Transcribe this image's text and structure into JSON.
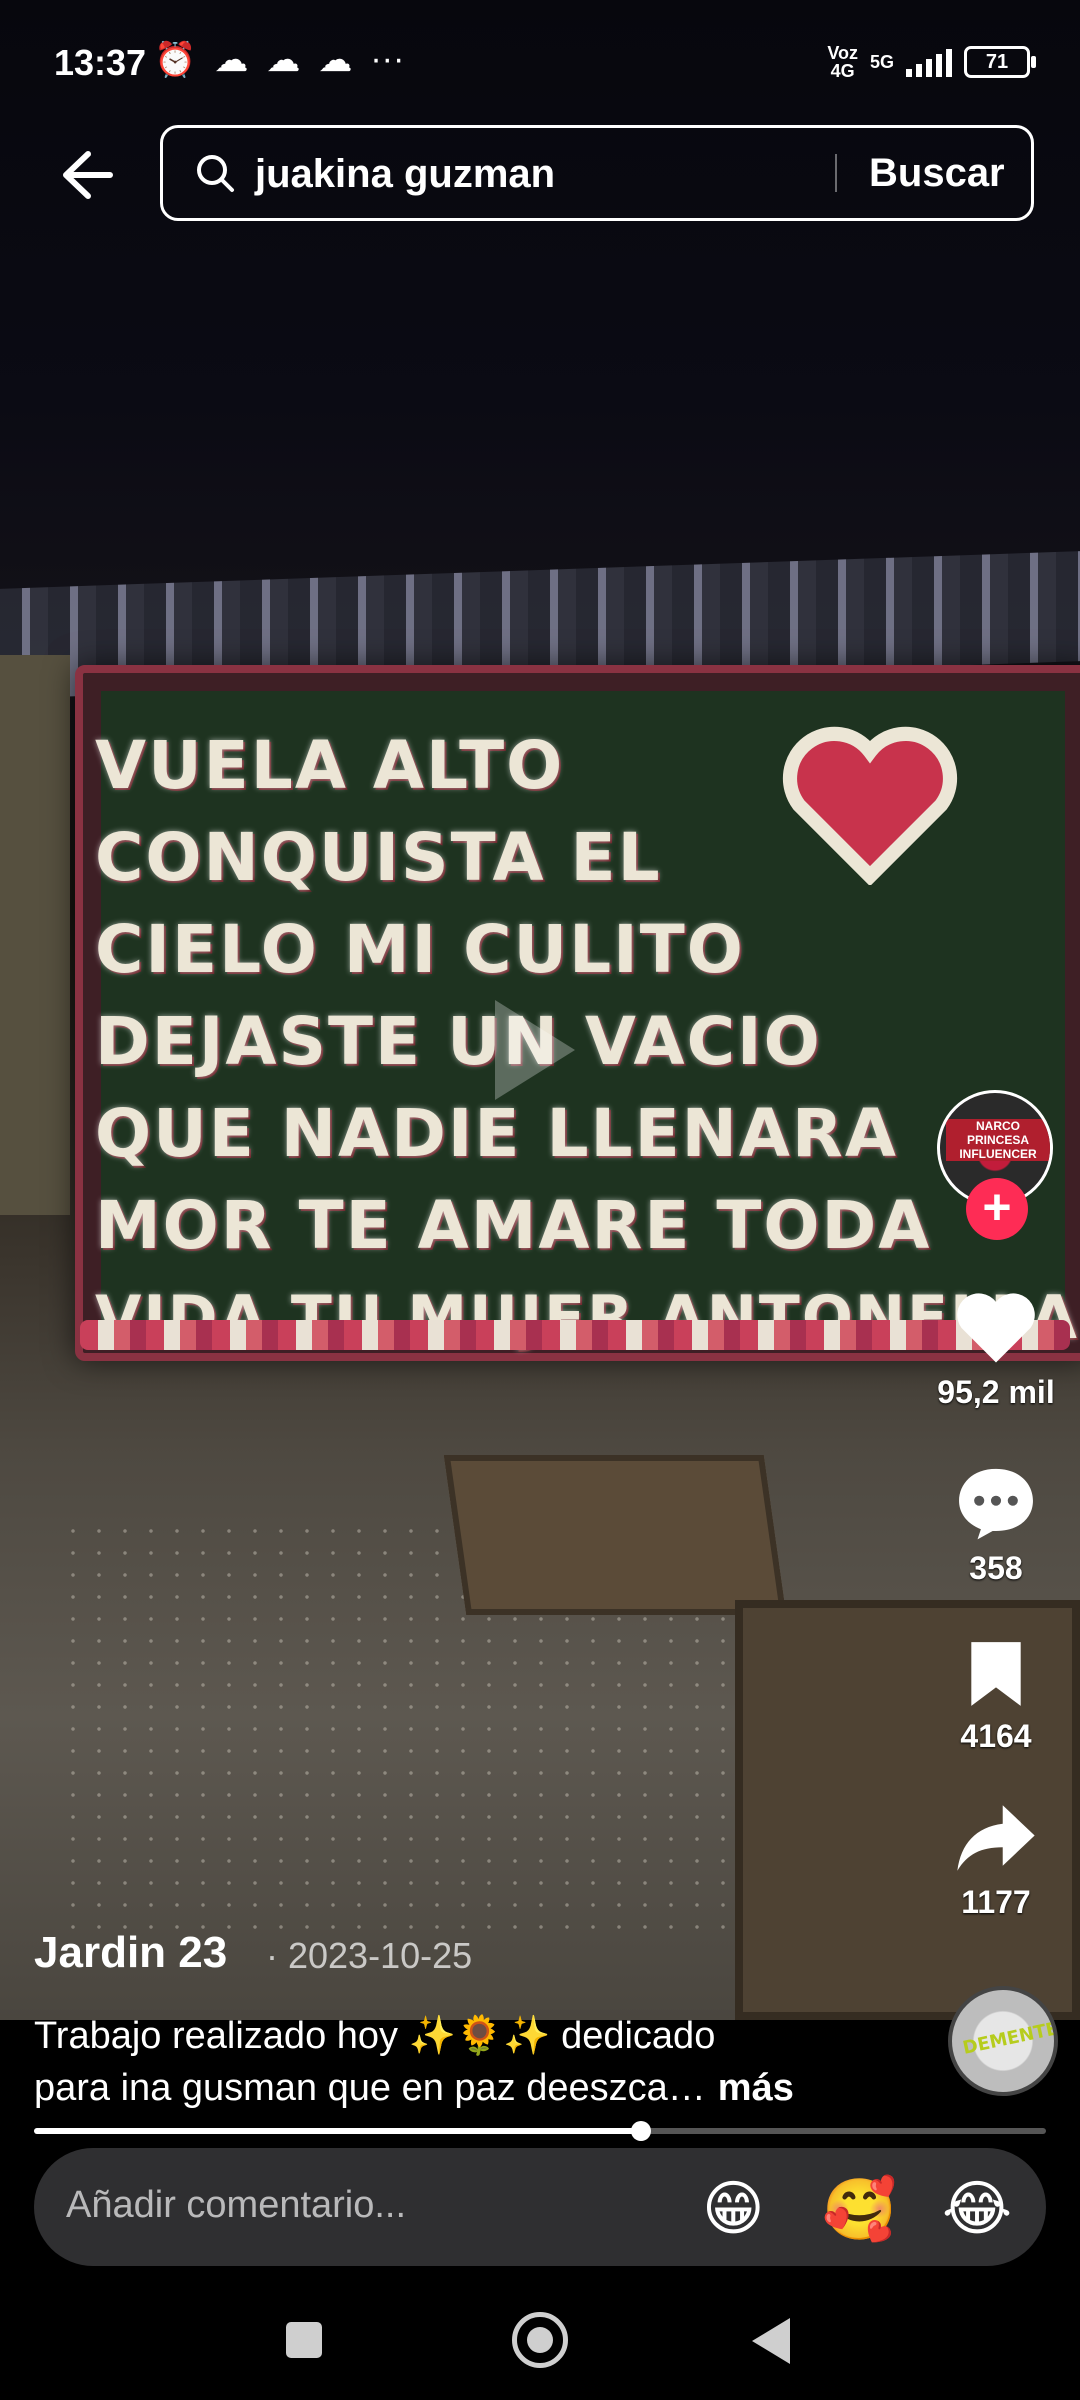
{
  "status_bar": {
    "time": "13:37",
    "network_top": "Voz",
    "network_bottom": "4G",
    "network_5g": "5G",
    "battery": "71"
  },
  "search": {
    "query": "juakina guzman",
    "button": "Buscar"
  },
  "video": {
    "banner_lines": [
      "VUELA ALTO",
      "CONQUISTA EL",
      "CIELO MI CULITO",
      "DEJASTE UN VACIO",
      "QUE NADIE LLENARA",
      "MOR TE AMARE TODA",
      "VIDA TU MUJER ANTONELLA"
    ]
  },
  "rail": {
    "avatar_label": "NARCO PRINCESA INFLUENCER",
    "likes": "95,2 mil",
    "comments": "358",
    "saves": "4164",
    "shares": "1177",
    "music_label": "DEMENTE"
  },
  "post": {
    "author": "Jardin 23",
    "date": "· 2023-10-25",
    "caption_line1": "Trabajo realizado hoy ✨🌻✨ dedicado",
    "caption_line2": "para ina gusman que en paz deeszca…",
    "more": "más",
    "progress": 0.6
  },
  "comment_bar": {
    "placeholder": "Añadir comentario...",
    "emojis": [
      "😁",
      "🥰",
      "😂"
    ]
  },
  "colors": {
    "accent": "#fe2c55",
    "comment_bg": "#2f2f31"
  }
}
